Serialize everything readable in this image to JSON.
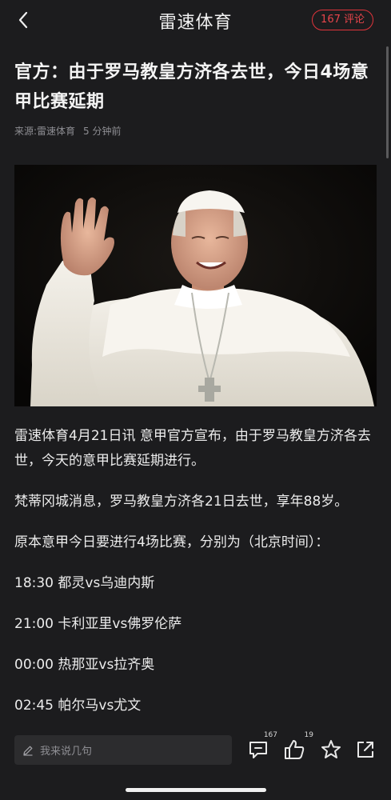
{
  "header": {
    "title": "雷速体育",
    "comment_badge": "167 评论"
  },
  "icons": {
    "back": "chevron-left-icon",
    "edit": "pencil-icon",
    "comment": "comment-icon",
    "like": "thumbs-up-icon",
    "favorite": "star-icon",
    "share": "share-icon"
  },
  "colors": {
    "background": "#1c1c1e",
    "accent": "#e0343b",
    "text": "#ececec",
    "muted": "#8e8e93"
  },
  "article": {
    "title": "官方：由于罗马教皇方济各去世，今日4场意甲比赛延期",
    "source": "来源:雷速体育",
    "time": "5 分钟前",
    "paragraphs": [
      "雷速体育4月21日讯 意甲官方宣布，由于罗马教皇方济各去世，今天的意甲比赛延期进行。",
      "梵蒂冈城消息，罗马教皇方济各21日去世，享年88岁。",
      "原本意甲今日要进行4场比赛，分别为（北京时间）：",
      "18:30 都灵vs乌迪内斯",
      "21:00 卡利亚里vs佛罗伦萨",
      "00:00 热那亚vs拉齐奥",
      "02:45 帕尔马vs尤文"
    ]
  },
  "bottom_bar": {
    "input_placeholder": "我来说几句",
    "comment_count": "167",
    "like_count": "19"
  }
}
